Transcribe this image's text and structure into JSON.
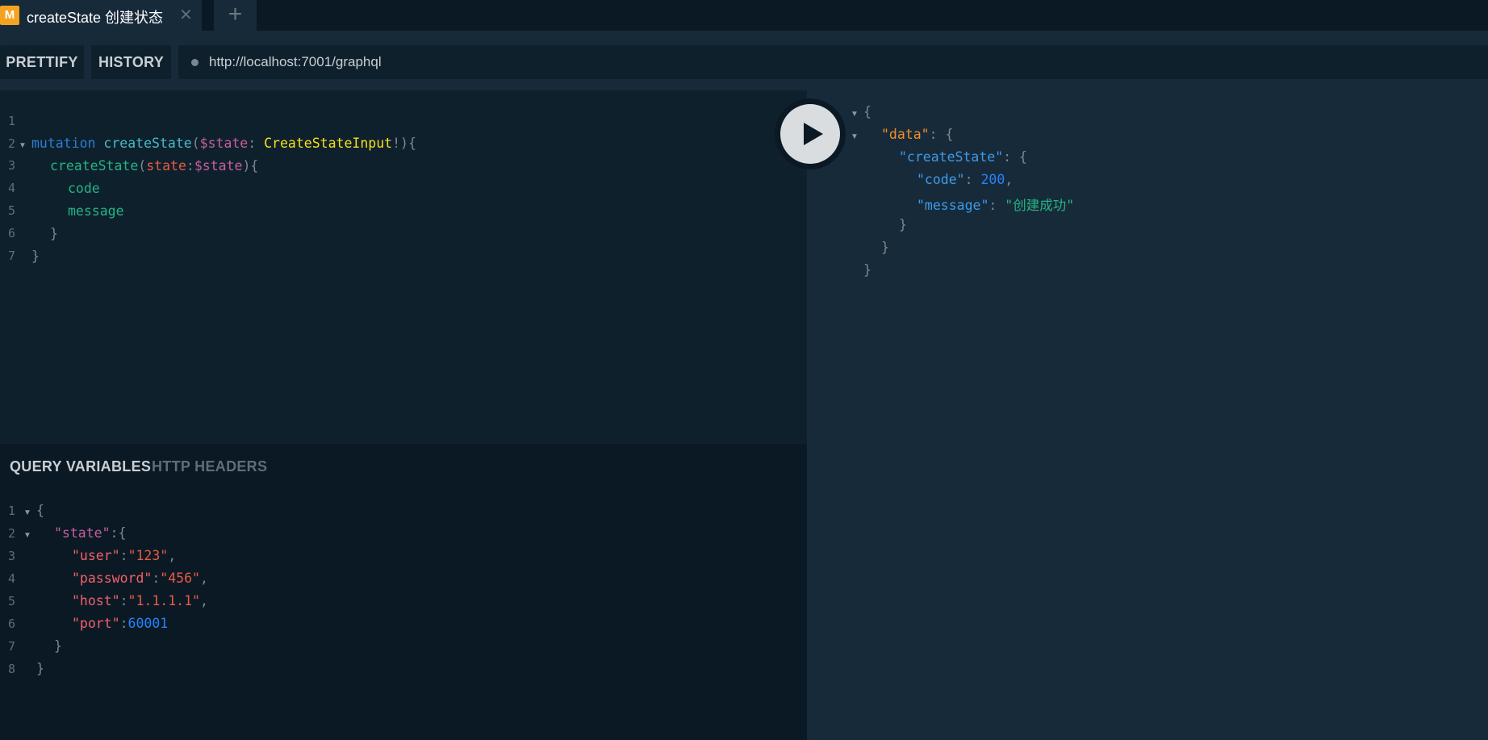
{
  "tab": {
    "badge": "M",
    "title": "createState 创建状态",
    "close_glyph": "✕",
    "add_glyph": "+"
  },
  "toolbar": {
    "prettify": "PRETTIFY",
    "history": "HISTORY",
    "url": "http://localhost:7001/graphql"
  },
  "query": {
    "line_numbers": [
      "1",
      "2",
      "3",
      "4",
      "5",
      "6",
      "7"
    ],
    "l2": {
      "kw": "mutation",
      "name": "createState",
      "open": "(",
      "var": "$state",
      "colon": ": ",
      "type": "CreateStateInput",
      "bang": "!",
      "close": "){"
    },
    "l3": {
      "field": "createState",
      "open": "(",
      "arg": "state",
      "colon": ":",
      "var": "$state",
      "close": "){"
    },
    "l4": {
      "field": "code"
    },
    "l5": {
      "field": "message"
    },
    "l6": "}",
    "l7": "}"
  },
  "variables_panel": {
    "tab_query_variables": "QUERY VARIABLES",
    "tab_http_headers": "HTTP HEADERS",
    "line_numbers": [
      "1",
      "2",
      "3",
      "4",
      "5",
      "6",
      "7",
      "8"
    ],
    "l1": "{",
    "l2": {
      "key": "\"state\"",
      "rest": ":{"
    },
    "l3": {
      "key": "\"user\"",
      "colon": ":",
      "val": "\"123\"",
      "comma": ","
    },
    "l4": {
      "key": "\"password\"",
      "colon": ":",
      "val": "\"456\"",
      "comma": ","
    },
    "l5": {
      "key": "\"host\"",
      "colon": ":",
      "val": "\"1.1.1.1\"",
      "comma": ","
    },
    "l6": {
      "key": "\"port\"",
      "colon": ":",
      "val": "60001"
    },
    "l7": "}",
    "l8": "}"
  },
  "result": {
    "l1": "{",
    "l2": {
      "key": "\"data\"",
      "rest": ": {"
    },
    "l3": {
      "key": "\"createState\"",
      "rest": ": {"
    },
    "l4": {
      "key": "\"code\"",
      "colon": ": ",
      "val": "200",
      "comma": ","
    },
    "l5": {
      "key": "\"message\"",
      "colon": ": ",
      "val": "\"创建成功\""
    },
    "l6": "}",
    "l7": "}",
    "l8": "}"
  },
  "colors": {
    "background": "#172a3a",
    "editor_bg": "#0f202d",
    "tabbar_bg": "#0b1924",
    "badge": "#f4a321",
    "keyword": "#2a7ed3",
    "type": "#f5e11a",
    "field": "#23b582",
    "variable": "#c85e9f",
    "number": "#2882f9",
    "result_data_key": "#f18f2a"
  },
  "icons": {
    "run": "play-icon",
    "close": "close-icon",
    "add": "plus-icon",
    "fold": "triangle-down-icon"
  }
}
